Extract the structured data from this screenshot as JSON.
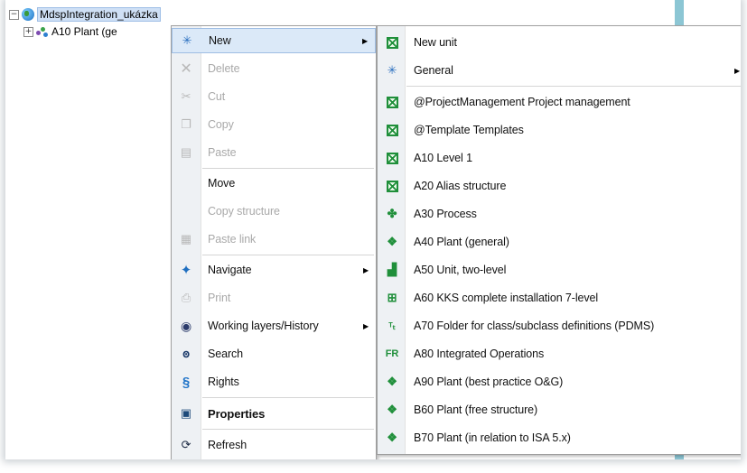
{
  "tree": {
    "root_label": "MdspIntegration_ukázka",
    "child_label": "A10   Plant (ge"
  },
  "context_menu": {
    "items": [
      {
        "label": "New",
        "icon": "new-star-icon",
        "disabled": false,
        "submenu": true
      },
      {
        "label": "Delete",
        "icon": "delete-x-icon",
        "disabled": true
      },
      {
        "label": "Cut",
        "icon": "scissors-icon",
        "disabled": true
      },
      {
        "label": "Copy",
        "icon": "copy-icon",
        "disabled": true
      },
      {
        "label": "Paste",
        "icon": "paste-icon",
        "disabled": true
      },
      {
        "label": "Move",
        "icon": "",
        "disabled": false
      },
      {
        "label": "Copy structure",
        "icon": "",
        "disabled": true
      },
      {
        "label": "Paste link",
        "icon": "paste-link-icon",
        "disabled": true
      },
      {
        "label": "Navigate",
        "icon": "navigate-icon",
        "disabled": false,
        "submenu": true
      },
      {
        "label": "Print",
        "icon": "printer-icon",
        "disabled": true
      },
      {
        "label": "Working layers/History",
        "icon": "layers-icon",
        "disabled": false,
        "submenu": true
      },
      {
        "label": "Search",
        "icon": "binoculars-icon",
        "disabled": false
      },
      {
        "label": "Rights",
        "icon": "section-icon",
        "disabled": false
      },
      {
        "label": "Properties",
        "icon": "properties-icon",
        "disabled": false,
        "bold": true
      },
      {
        "label": "Refresh",
        "icon": "refresh-icon",
        "disabled": false
      }
    ]
  },
  "submenu": {
    "items": [
      {
        "label": "New unit",
        "icon": "xbox-icon"
      },
      {
        "label": "General",
        "icon": "new-star-icon",
        "submenu": true
      },
      {
        "label": "@ProjectManagement  Project management",
        "icon": "xbox-icon"
      },
      {
        "label": "@Template  Templates",
        "icon": "xbox-icon"
      },
      {
        "label": "A10  Level 1",
        "icon": "xbox-icon"
      },
      {
        "label": "A20  Alias structure",
        "icon": "xbox-icon"
      },
      {
        "label": "A30  Process",
        "icon": "process-icon"
      },
      {
        "label": "A40  Plant (general)",
        "icon": "plant-icon"
      },
      {
        "label": "A50  Unit, two-level",
        "icon": "unit-icon"
      },
      {
        "label": "A60  KKS complete installation 7-level",
        "icon": "kks-icon"
      },
      {
        "label": "A70  Folder for class/subclass definitions (PDMS)",
        "icon": "folder-tree-icon"
      },
      {
        "label": "A80  Integrated Operations",
        "icon": "fr-icon",
        "icon_text": "FR"
      },
      {
        "label": "A90  Plant (best practice O&G)",
        "icon": "plant-icon"
      },
      {
        "label": "B60  Plant (free structure)",
        "icon": "plant-icon"
      },
      {
        "label": "B70  Plant (in relation to ISA 5.x)",
        "icon": "plant-icon"
      }
    ]
  },
  "colors": {
    "highlight": "#dbe9f8",
    "gutter": "#eef1f4",
    "icon_green": "#1f8f3a",
    "disabled_text": "#a9a9a9"
  }
}
